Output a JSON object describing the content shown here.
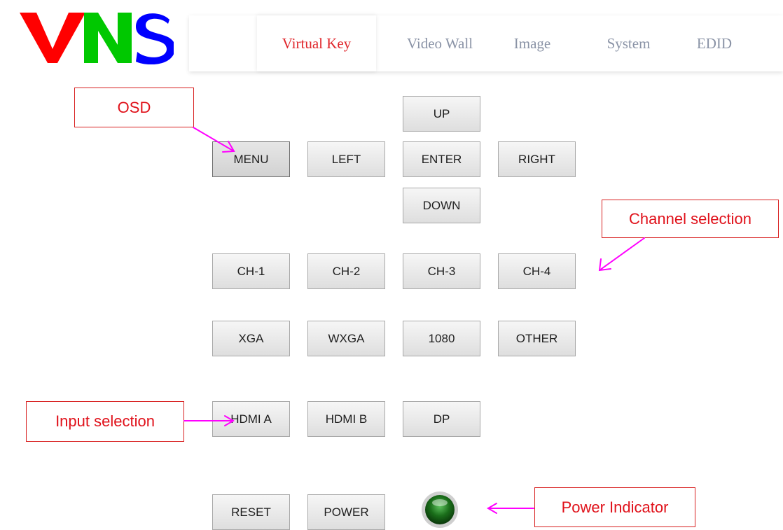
{
  "logo": {
    "text": "VNS",
    "colors": {
      "v": "#ff0000",
      "n": "#00c800",
      "s": "#0000ff"
    }
  },
  "nav": {
    "tabs": [
      {
        "label": "Virtual Key",
        "active": true
      },
      {
        "label": "Video Wall"
      },
      {
        "label": "Image"
      },
      {
        "label": "System"
      },
      {
        "label": "EDID"
      }
    ]
  },
  "keys": {
    "up": "UP",
    "menu": "MENU",
    "left": "LEFT",
    "enter": "ENTER",
    "right": "RIGHT",
    "down": "DOWN",
    "ch1": "CH-1",
    "ch2": "CH-2",
    "ch3": "CH-3",
    "ch4": "CH-4",
    "xga": "XGA",
    "wxga": "WXGA",
    "res1080": "1080",
    "other": "OTHER",
    "hdmi_a": "HDMI A",
    "hdmi_b": "HDMI B",
    "dp": "DP",
    "reset": "RESET",
    "power": "POWER"
  },
  "power_indicator": {
    "state": "on",
    "color": "#1a6e1a"
  },
  "annotations": {
    "osd": "OSD",
    "channel_selection": "Channel selection",
    "input_selection": "Input selection",
    "power_indicator": "Power Indicator",
    "arrow_color": "#ff00ff"
  }
}
